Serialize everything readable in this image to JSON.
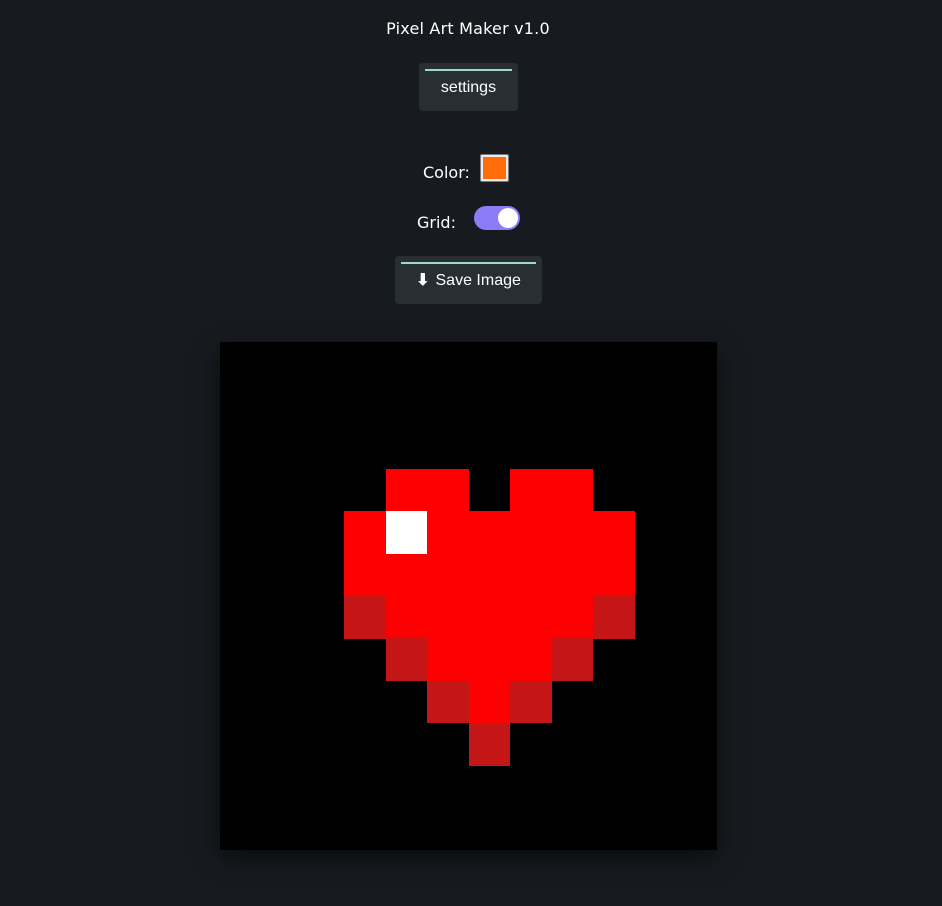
{
  "app": {
    "title": "Pixel Art Maker v1.0"
  },
  "toolbar": {
    "settings_label": "settings",
    "color_label": "Color:",
    "color_value": "#ff6d0a",
    "grid_label": "Grid:",
    "grid_enabled": true,
    "save_label": "Save Image",
    "save_icon": "download-arrow-icon"
  },
  "canvas": {
    "columns": 12,
    "rows": 12,
    "background": "#000000",
    "palette": {
      "R": "#ff0000",
      "D": "#c41616",
      "W": "#ffffff"
    },
    "pixels": [
      "............",
      "............",
      "............",
      "....RR.RR...",
      "...RWRRRRR..",
      "...RRRRRRR..",
      "...DRRRRRD..",
      "....DRRRD...",
      ".....DRD....",
      "......D.....",
      "............",
      "............"
    ]
  }
}
